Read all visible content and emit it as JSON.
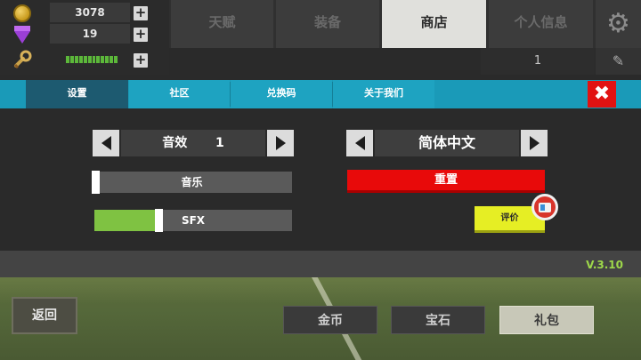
{
  "resources": {
    "coins": "3078",
    "gems": "19",
    "plus": "+"
  },
  "top_tabs": [
    "天赋",
    "装备",
    "商店",
    "个人信息"
  ],
  "active_tab_index": 2,
  "sub_value": "1",
  "edit_glyph": "✎",
  "gear_glyph": "⚙",
  "settings_tabs": [
    "设置",
    "社区",
    "兑换码",
    "关于我们"
  ],
  "close_glyph": "✖",
  "settings": {
    "sound_label": "音效",
    "sound_value": "1",
    "language_label": "简体中文",
    "music_label": "音乐",
    "music_level": 0.0,
    "sfx_label": "SFX",
    "sfx_level": 0.32,
    "reset_label": "重置",
    "rate_label": "评价"
  },
  "version": "V.3.10",
  "bottom": {
    "back_label": "返回",
    "coins_label": "金币",
    "gems_label": "宝石",
    "bundle_label": "礼包"
  },
  "colors": {
    "accent_blue": "#1ea3c1",
    "danger_red": "#e80a0a",
    "rate_yellow": "#e6ee24",
    "energy_green": "#5cb83a",
    "version_green": "#9ed84a"
  },
  "icons": {
    "coin": "coin-icon",
    "gem": "gem-icon",
    "wrench": "wrench-icon",
    "gear": "gear-icon",
    "edit": "edit-icon",
    "close": "close-icon"
  }
}
